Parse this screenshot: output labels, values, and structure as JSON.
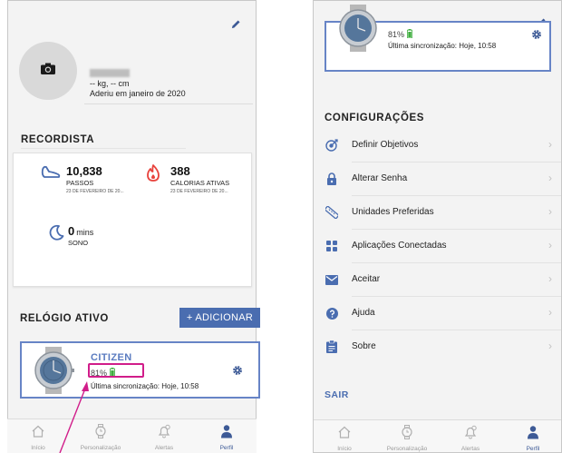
{
  "left_screen": {
    "profile": {
      "stats": "-- kg, -- cm",
      "joined": "Aderiu em janeiro de 2020"
    },
    "records_section_title": "RECORDISTA",
    "records": [
      {
        "value": "10,838",
        "unit": "",
        "label": "PASSOS",
        "date": "23 DE FEVEREIRO DE 20...",
        "icon": "shoe-icon",
        "color": "#4a6db0"
      },
      {
        "value": "388",
        "unit": "",
        "label": "CALORIAS ATIVAS",
        "date": "23 DE FEVEREIRO DE 20...",
        "icon": "flame-icon",
        "color": "#e8423c"
      },
      {
        "value": "0",
        "unit": "mins",
        "label": "SONO",
        "date": "",
        "icon": "moon-icon",
        "color": "#4a6db0"
      }
    ],
    "active_watch_title": "RELÓGIO ATIVO",
    "add_button": "+ ADICIONAR",
    "watch": {
      "name": "CITIZEN",
      "battery": "81%",
      "sync": "Última sincronização: Hoje, 10:58"
    }
  },
  "right_screen": {
    "watch": {
      "battery": "81%",
      "sync": "Última sincronização: Hoje, 10:58"
    },
    "settings_title": "CONFIGURAÇÕES",
    "settings": [
      {
        "label": "Definir Objetivos",
        "icon": "target-icon"
      },
      {
        "label": "Alterar Senha",
        "icon": "lock-icon"
      },
      {
        "label": "Unidades Preferidas",
        "icon": "ruler-icon"
      },
      {
        "label": "Aplicações Conectadas",
        "icon": "apps-grid-icon"
      },
      {
        "label": "Aceitar",
        "icon": "mail-icon"
      },
      {
        "label": "Ajuda",
        "icon": "help-icon"
      },
      {
        "label": "Sobre",
        "icon": "clipboard-icon"
      }
    ],
    "logout": "SAIR"
  },
  "tabbar": [
    {
      "label": "Início",
      "icon": "home-icon",
      "active": false
    },
    {
      "label": "Personalização",
      "icon": "watch-icon",
      "active": false
    },
    {
      "label": "Alertas",
      "icon": "bell-icon",
      "active": false
    },
    {
      "label": "Perfil",
      "icon": "person-icon",
      "active": true
    }
  ],
  "colors": {
    "accent": "#4a6db0",
    "highlight": "#d11d8a",
    "battery": "#3fae3f",
    "flame": "#e8423c"
  }
}
